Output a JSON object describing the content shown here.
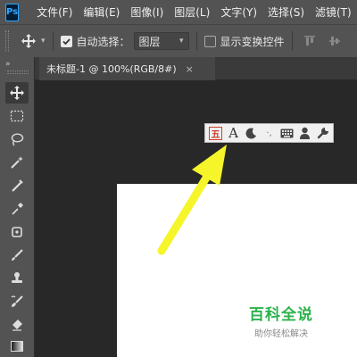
{
  "app": {
    "logo_text": "Ps"
  },
  "menu": [
    "文件(F)",
    "编辑(E)",
    "图像(I)",
    "图层(L)",
    "文字(Y)",
    "选择(S)",
    "滤镜(T)"
  ],
  "options": {
    "auto_select_label": "自动选择：",
    "auto_select_checked": true,
    "layer_select_value": "图层",
    "show_transform_label": "显示变换控件",
    "show_transform_checked": false
  },
  "document": {
    "tab_title": "未标题-1 @ 100%(RGB/8#)",
    "close_glyph": "×"
  },
  "toolbar": {
    "collapse_glyph": "»",
    "tools": [
      "move-tool-icon",
      "rect-marquee-tool-icon",
      "lasso-tool-icon",
      "magic-wand-tool-icon",
      "crop-tool-icon",
      "eyedropper-tool-icon",
      "healing-brush-tool-icon",
      "brush-tool-icon",
      "clone-stamp-tool-icon",
      "history-brush-tool-icon",
      "eraser-tool-icon",
      "gradient-tool-icon"
    ]
  },
  "ime_toolbar": {
    "icons": [
      "ime-chinese-icon",
      "font-icon",
      "moon-icon",
      "punctuation-icon",
      "keyboard-icon",
      "user-icon",
      "wrench-icon"
    ],
    "chinese_glyph": "五",
    "font_glyph": "A",
    "punct_glyph": "·,"
  },
  "watermark": {
    "title": "百科全说",
    "subtitle": "助你轻松解决"
  },
  "colors": {
    "menubar_bg": "#535353",
    "workspace_bg": "#282828",
    "arrow_yellow": "#f5f52a",
    "watermark_green": "#2bb24c"
  }
}
